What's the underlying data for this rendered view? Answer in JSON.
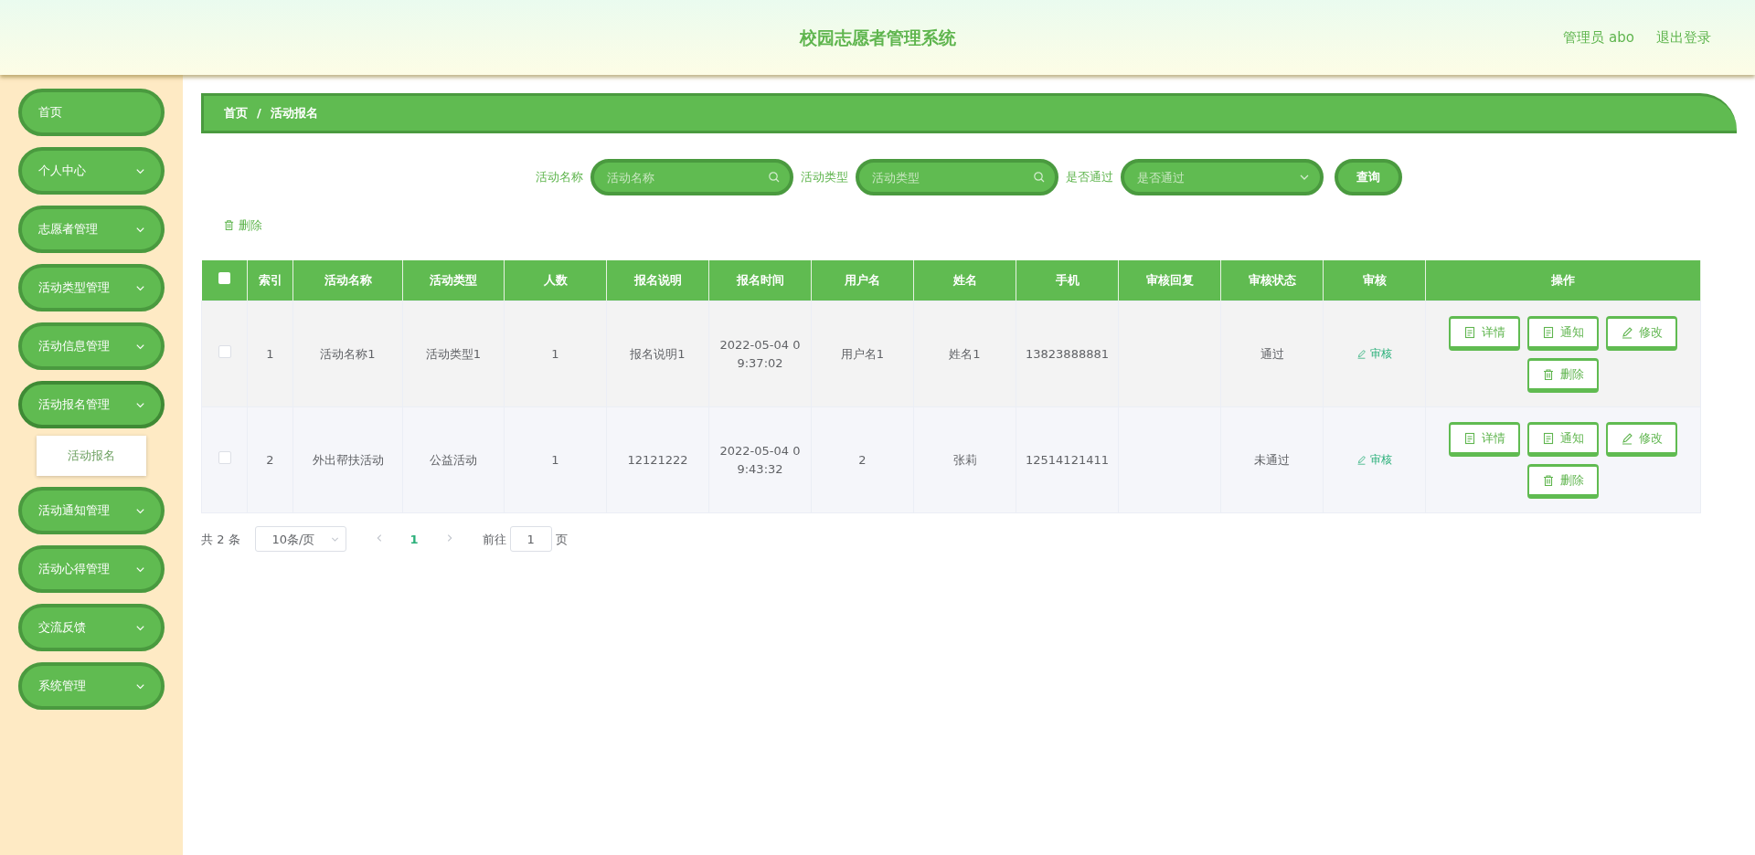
{
  "header": {
    "title": "校园志愿者管理系统",
    "user": "管理员 abo",
    "logout": "退出登录"
  },
  "sidebar": {
    "items": [
      {
        "label": "首页",
        "kind": "link",
        "expanded": false
      },
      {
        "label": "个人中心",
        "kind": "menu",
        "expanded": false
      },
      {
        "label": "志愿者管理",
        "kind": "menu",
        "expanded": false
      },
      {
        "label": "活动类型管理",
        "kind": "menu",
        "expanded": false
      },
      {
        "label": "活动信息管理",
        "kind": "menu",
        "expanded": false
      },
      {
        "label": "活动报名管理",
        "kind": "menu",
        "expanded": true,
        "children": [
          {
            "label": "活动报名"
          }
        ]
      },
      {
        "label": "活动通知管理",
        "kind": "menu",
        "expanded": false
      },
      {
        "label": "活动心得管理",
        "kind": "menu",
        "expanded": false
      },
      {
        "label": "交流反馈",
        "kind": "menu",
        "expanded": false
      },
      {
        "label": "系统管理",
        "kind": "menu",
        "expanded": false
      }
    ]
  },
  "breadcrumb": {
    "items": [
      "首页",
      "活动报名"
    ],
    "separator": "/"
  },
  "search": {
    "fields": [
      {
        "label": "活动名称",
        "placeholder": "活动名称",
        "kind": "search"
      },
      {
        "label": "活动类型",
        "placeholder": "活动类型",
        "kind": "search"
      },
      {
        "label": "是否通过",
        "placeholder": "是否通过",
        "kind": "select"
      }
    ],
    "button": "查询"
  },
  "toolbar": {
    "delete": "删除"
  },
  "table": {
    "select_all": {
      "checked": false
    },
    "columns": [
      "索引",
      "活动名称",
      "活动类型",
      "人数",
      "报名说明",
      "报名时间",
      "用户名",
      "姓名",
      "手机",
      "审核回复",
      "审核状态",
      "审核",
      "操作"
    ],
    "rows": [
      {
        "selected": false,
        "cells": [
          "1",
          "活动名称1",
          "活动类型1",
          "1",
          "报名说明1",
          "2022-05-04 09:37:02",
          "用户名1",
          "姓名1",
          "13823888881",
          "",
          "通过"
        ],
        "review": "审核",
        "actions": [
          {
            "label": "详情",
            "kind": "doc"
          },
          {
            "label": "通知",
            "kind": "doc"
          },
          {
            "label": "修改",
            "kind": "edit"
          },
          {
            "label": "删除",
            "kind": "trash"
          }
        ]
      },
      {
        "selected": false,
        "cells": [
          "2",
          "外出帮扶活动",
          "公益活动",
          "1",
          "12121222",
          "2022-05-04 09:43:32",
          "2",
          "张莉",
          "12514121411",
          "",
          "未通过"
        ],
        "review": "审核",
        "actions": [
          {
            "label": "详情",
            "kind": "doc"
          },
          {
            "label": "通知",
            "kind": "doc"
          },
          {
            "label": "修改",
            "kind": "edit"
          },
          {
            "label": "删除",
            "kind": "trash"
          }
        ]
      }
    ]
  },
  "pagination": {
    "total": "共 2 条",
    "page_size": "10条/页",
    "pages": [
      {
        "label": "1",
        "selected": true
      }
    ],
    "goto": "前往",
    "goto_value": "1",
    "page_suffix": "页"
  }
}
